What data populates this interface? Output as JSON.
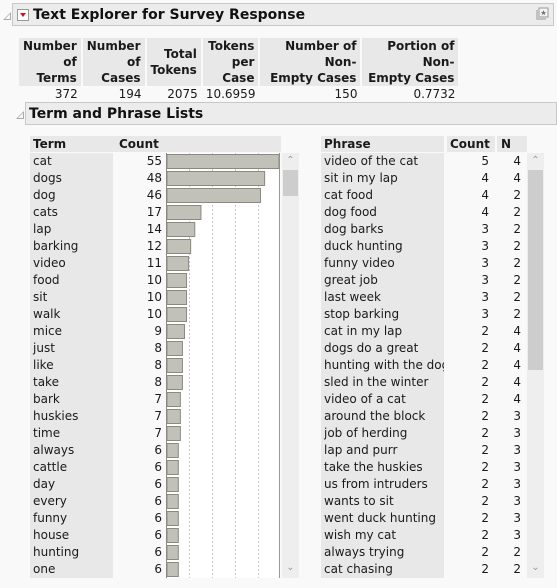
{
  "window": {
    "title": "Text Explorer for Survey Response"
  },
  "summary": {
    "headers": [
      "Number\nof Terms",
      "Number\nof Cases",
      "Total\nTokens",
      "Tokens\nper Case",
      "Number of Non-\nEmpty Cases",
      "Portion of Non-\nEmpty Cases"
    ],
    "values": [
      "372",
      "194",
      "2075",
      "10.6959",
      "150",
      "0.7732"
    ]
  },
  "lists_section": {
    "title": "Term and Phrase Lists"
  },
  "term_table": {
    "headers": {
      "term": "Term",
      "count": "Count"
    },
    "rows": [
      {
        "term": "cat",
        "count": "55"
      },
      {
        "term": "dogs",
        "count": "48"
      },
      {
        "term": "dog",
        "count": "46"
      },
      {
        "term": "cats",
        "count": "17"
      },
      {
        "term": "lap",
        "count": "14"
      },
      {
        "term": "barking",
        "count": "12"
      },
      {
        "term": "video",
        "count": "11"
      },
      {
        "term": "food",
        "count": "10"
      },
      {
        "term": "sit",
        "count": "10"
      },
      {
        "term": "walk",
        "count": "10"
      },
      {
        "term": "mice",
        "count": "9"
      },
      {
        "term": "just",
        "count": "8"
      },
      {
        "term": "like",
        "count": "8"
      },
      {
        "term": "take",
        "count": "8"
      },
      {
        "term": "bark",
        "count": "7"
      },
      {
        "term": "huskies",
        "count": "7"
      },
      {
        "term": "time",
        "count": "7"
      },
      {
        "term": "always",
        "count": "6"
      },
      {
        "term": "cattle",
        "count": "6"
      },
      {
        "term": "day",
        "count": "6"
      },
      {
        "term": "every",
        "count": "6"
      },
      {
        "term": "funny",
        "count": "6"
      },
      {
        "term": "house",
        "count": "6"
      },
      {
        "term": "hunting",
        "count": "6"
      },
      {
        "term": "one",
        "count": "6"
      }
    ],
    "bar_max": 55,
    "scroll_position": 0.0
  },
  "phrase_table": {
    "headers": {
      "phrase": "Phrase",
      "count": "Count",
      "n": "N"
    },
    "rows": [
      {
        "phrase": "video of the cat",
        "count": "5",
        "n": "4"
      },
      {
        "phrase": "sit in my lap",
        "count": "4",
        "n": "4"
      },
      {
        "phrase": "cat food",
        "count": "4",
        "n": "2"
      },
      {
        "phrase": "dog food",
        "count": "4",
        "n": "2"
      },
      {
        "phrase": "dog barks",
        "count": "3",
        "n": "2"
      },
      {
        "phrase": "duck hunting",
        "count": "3",
        "n": "2"
      },
      {
        "phrase": "funny video",
        "count": "3",
        "n": "2"
      },
      {
        "phrase": "great job",
        "count": "3",
        "n": "2"
      },
      {
        "phrase": "last week",
        "count": "3",
        "n": "2"
      },
      {
        "phrase": "stop barking",
        "count": "3",
        "n": "2"
      },
      {
        "phrase": "cat in my lap",
        "count": "2",
        "n": "4"
      },
      {
        "phrase": "dogs do a great",
        "count": "2",
        "n": "4"
      },
      {
        "phrase": "hunting with the dogs",
        "count": "2",
        "n": "4"
      },
      {
        "phrase": "sled in the winter",
        "count": "2",
        "n": "4"
      },
      {
        "phrase": "video of a cat",
        "count": "2",
        "n": "4"
      },
      {
        "phrase": "around the block",
        "count": "2",
        "n": "3"
      },
      {
        "phrase": "job of herding",
        "count": "2",
        "n": "3"
      },
      {
        "phrase": "lap and purr",
        "count": "2",
        "n": "3"
      },
      {
        "phrase": "take the huskies",
        "count": "2",
        "n": "3"
      },
      {
        "phrase": "us from intruders",
        "count": "2",
        "n": "3"
      },
      {
        "phrase": "wants to sit",
        "count": "2",
        "n": "3"
      },
      {
        "phrase": "went duck hunting",
        "count": "2",
        "n": "3"
      },
      {
        "phrase": "wish my cat",
        "count": "2",
        "n": "3"
      },
      {
        "phrase": "always trying",
        "count": "2",
        "n": "2"
      },
      {
        "phrase": "cat chasing",
        "count": "2",
        "n": "2"
      }
    ],
    "scroll_position": 0.0
  },
  "colors": {
    "bar_fill": "#c2c1b9",
    "bar_stroke": "#8a8a80",
    "menu_arrow": "#d0101a"
  }
}
